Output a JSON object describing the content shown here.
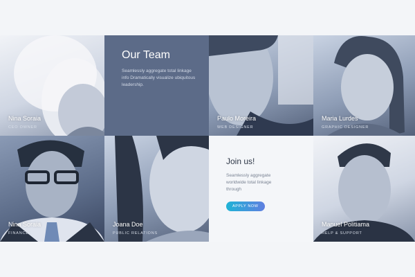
{
  "team_block": {
    "heading": "Our Team",
    "text": "Seamlessly aggregate total linkage info Dramatically visualize ubiquitous leadership."
  },
  "join_block": {
    "heading": "Join us!",
    "text": "Seamlessly aggregate worldwide total linkage through",
    "button": "APPLY NOW"
  },
  "members": [
    {
      "name": "Nina Soraia",
      "role": "CEO Owner"
    },
    {
      "name": "Paulo Moreira",
      "role": "Web Designer"
    },
    {
      "name": "Maria Lurdes",
      "role": "Graphic Designer"
    },
    {
      "name": "Nina Soraia",
      "role": "Finances"
    },
    {
      "name": "Joana Doe",
      "role": "Public Relations"
    },
    {
      "name": "Manuel Politiama",
      "role": "Help & Support"
    }
  ],
  "colors": {
    "team_bg": "#5c6b88",
    "page_bg": "#f3f5f8",
    "button_start": "#1fb3d6",
    "button_end": "#5f7fe0"
  }
}
